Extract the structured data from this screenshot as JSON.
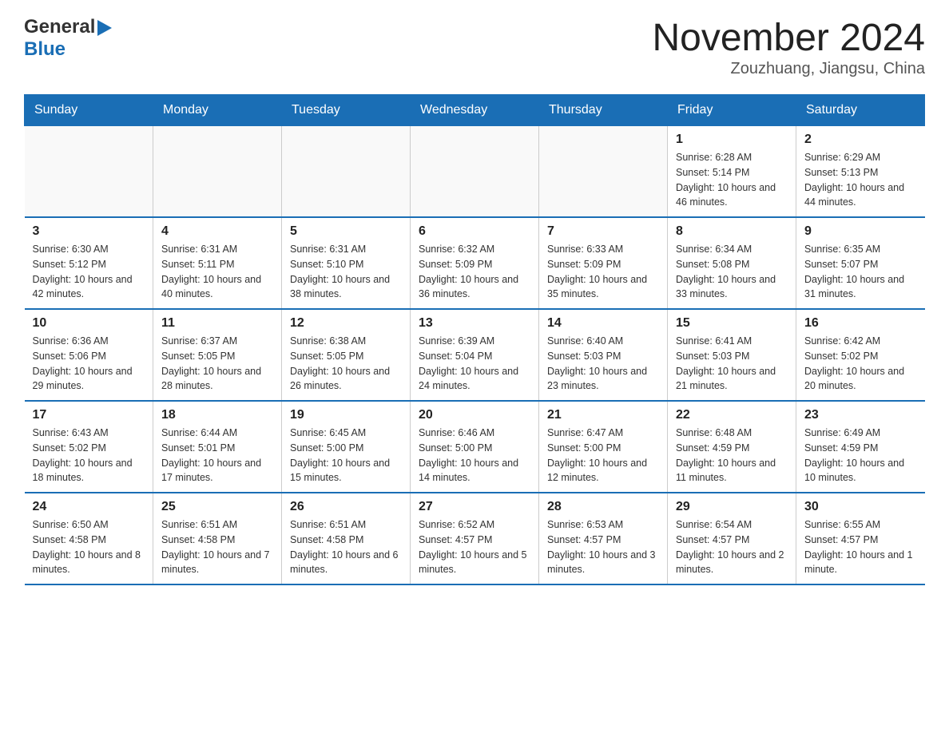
{
  "header": {
    "logo": {
      "general": "General",
      "arrow": "▶",
      "blue": "Blue"
    },
    "title": "November 2024",
    "location": "Zouzhuang, Jiangsu, China"
  },
  "days_of_week": [
    "Sunday",
    "Monday",
    "Tuesday",
    "Wednesday",
    "Thursday",
    "Friday",
    "Saturday"
  ],
  "weeks": [
    [
      {
        "day": "",
        "info": ""
      },
      {
        "day": "",
        "info": ""
      },
      {
        "day": "",
        "info": ""
      },
      {
        "day": "",
        "info": ""
      },
      {
        "day": "",
        "info": ""
      },
      {
        "day": "1",
        "info": "Sunrise: 6:28 AM\nSunset: 5:14 PM\nDaylight: 10 hours and 46 minutes."
      },
      {
        "day": "2",
        "info": "Sunrise: 6:29 AM\nSunset: 5:13 PM\nDaylight: 10 hours and 44 minutes."
      }
    ],
    [
      {
        "day": "3",
        "info": "Sunrise: 6:30 AM\nSunset: 5:12 PM\nDaylight: 10 hours and 42 minutes."
      },
      {
        "day": "4",
        "info": "Sunrise: 6:31 AM\nSunset: 5:11 PM\nDaylight: 10 hours and 40 minutes."
      },
      {
        "day": "5",
        "info": "Sunrise: 6:31 AM\nSunset: 5:10 PM\nDaylight: 10 hours and 38 minutes."
      },
      {
        "day": "6",
        "info": "Sunrise: 6:32 AM\nSunset: 5:09 PM\nDaylight: 10 hours and 36 minutes."
      },
      {
        "day": "7",
        "info": "Sunrise: 6:33 AM\nSunset: 5:09 PM\nDaylight: 10 hours and 35 minutes."
      },
      {
        "day": "8",
        "info": "Sunrise: 6:34 AM\nSunset: 5:08 PM\nDaylight: 10 hours and 33 minutes."
      },
      {
        "day": "9",
        "info": "Sunrise: 6:35 AM\nSunset: 5:07 PM\nDaylight: 10 hours and 31 minutes."
      }
    ],
    [
      {
        "day": "10",
        "info": "Sunrise: 6:36 AM\nSunset: 5:06 PM\nDaylight: 10 hours and 29 minutes."
      },
      {
        "day": "11",
        "info": "Sunrise: 6:37 AM\nSunset: 5:05 PM\nDaylight: 10 hours and 28 minutes."
      },
      {
        "day": "12",
        "info": "Sunrise: 6:38 AM\nSunset: 5:05 PM\nDaylight: 10 hours and 26 minutes."
      },
      {
        "day": "13",
        "info": "Sunrise: 6:39 AM\nSunset: 5:04 PM\nDaylight: 10 hours and 24 minutes."
      },
      {
        "day": "14",
        "info": "Sunrise: 6:40 AM\nSunset: 5:03 PM\nDaylight: 10 hours and 23 minutes."
      },
      {
        "day": "15",
        "info": "Sunrise: 6:41 AM\nSunset: 5:03 PM\nDaylight: 10 hours and 21 minutes."
      },
      {
        "day": "16",
        "info": "Sunrise: 6:42 AM\nSunset: 5:02 PM\nDaylight: 10 hours and 20 minutes."
      }
    ],
    [
      {
        "day": "17",
        "info": "Sunrise: 6:43 AM\nSunset: 5:02 PM\nDaylight: 10 hours and 18 minutes."
      },
      {
        "day": "18",
        "info": "Sunrise: 6:44 AM\nSunset: 5:01 PM\nDaylight: 10 hours and 17 minutes."
      },
      {
        "day": "19",
        "info": "Sunrise: 6:45 AM\nSunset: 5:00 PM\nDaylight: 10 hours and 15 minutes."
      },
      {
        "day": "20",
        "info": "Sunrise: 6:46 AM\nSunset: 5:00 PM\nDaylight: 10 hours and 14 minutes."
      },
      {
        "day": "21",
        "info": "Sunrise: 6:47 AM\nSunset: 5:00 PM\nDaylight: 10 hours and 12 minutes."
      },
      {
        "day": "22",
        "info": "Sunrise: 6:48 AM\nSunset: 4:59 PM\nDaylight: 10 hours and 11 minutes."
      },
      {
        "day": "23",
        "info": "Sunrise: 6:49 AM\nSunset: 4:59 PM\nDaylight: 10 hours and 10 minutes."
      }
    ],
    [
      {
        "day": "24",
        "info": "Sunrise: 6:50 AM\nSunset: 4:58 PM\nDaylight: 10 hours and 8 minutes."
      },
      {
        "day": "25",
        "info": "Sunrise: 6:51 AM\nSunset: 4:58 PM\nDaylight: 10 hours and 7 minutes."
      },
      {
        "day": "26",
        "info": "Sunrise: 6:51 AM\nSunset: 4:58 PM\nDaylight: 10 hours and 6 minutes."
      },
      {
        "day": "27",
        "info": "Sunrise: 6:52 AM\nSunset: 4:57 PM\nDaylight: 10 hours and 5 minutes."
      },
      {
        "day": "28",
        "info": "Sunrise: 6:53 AM\nSunset: 4:57 PM\nDaylight: 10 hours and 3 minutes."
      },
      {
        "day": "29",
        "info": "Sunrise: 6:54 AM\nSunset: 4:57 PM\nDaylight: 10 hours and 2 minutes."
      },
      {
        "day": "30",
        "info": "Sunrise: 6:55 AM\nSunset: 4:57 PM\nDaylight: 10 hours and 1 minute."
      }
    ]
  ]
}
